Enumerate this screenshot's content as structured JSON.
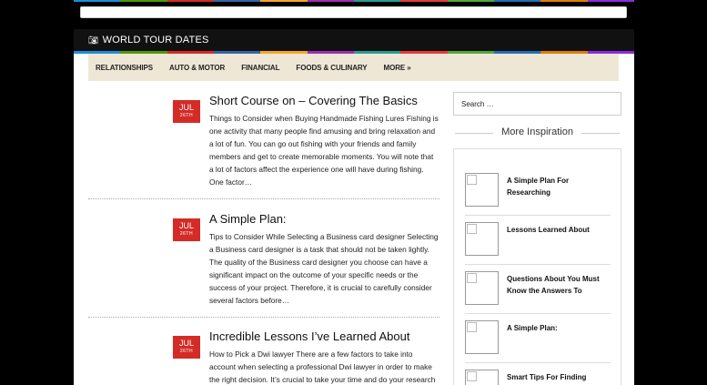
{
  "header": {
    "site_title": "WORLD TOUR DATES",
    "site_icon": "camera-icon"
  },
  "colors": {
    "stripe": [
      "#1a8ed8",
      "#4e9a06",
      "#d42b26",
      "#3465a4",
      "#f5a623",
      "#9b2fae",
      "#2a9d8f",
      "#e23b3b",
      "#57a639",
      "#1f6fb5",
      "#e07b00",
      "#8a2be2"
    ]
  },
  "nav": {
    "items": [
      "RELATIONSHIPS",
      "AUTO & MOTOR",
      "FINANCIAL",
      "FOODS & CULINARY",
      "MORE »"
    ]
  },
  "posts": [
    {
      "month": "JUL",
      "day": "26TH",
      "title": "Short Course on – Covering The Basics",
      "excerpt": "Things to Consider when Buying Handmade Fishing Lures Fishing is one activity that many people find amusing and bring relaxation and a lot of fun. You can go out fishing with your friends and family members and get to create memorable moments. You will note that a lot of factors affect the experience one will have during fishing. One factor…"
    },
    {
      "month": "JUL",
      "day": "26TH",
      "title": "A Simple Plan:",
      "excerpt": "Tips to Consider While Selecting a Business card designer Selecting a Business card designer is a task that should not be taken lightly. The quality of the Business card designer you choose can have a significant impact on the outcome of your specific needs or the success of your project. Therefore, it is crucial to carefully consider several factors before…"
    },
    {
      "month": "JUL",
      "day": "26TH",
      "title": "Incredible Lessons I’ve Learned About",
      "excerpt": "How to Pick a Dwi lawyer There are a few factors to take into account when selecting a professional Dwi lawyer in order to make the right decision. It’s crucial to take your time and do your research on the"
    }
  ],
  "sidebar": {
    "search_placeholder": "Search …",
    "inspiration_title": "More Inspiration",
    "items": [
      "A Simple Plan For Researching",
      "Lessons Learned About",
      "Questions About You Must Know the Answers To",
      "A Simple Plan:",
      "Smart Tips For Finding"
    ]
  }
}
